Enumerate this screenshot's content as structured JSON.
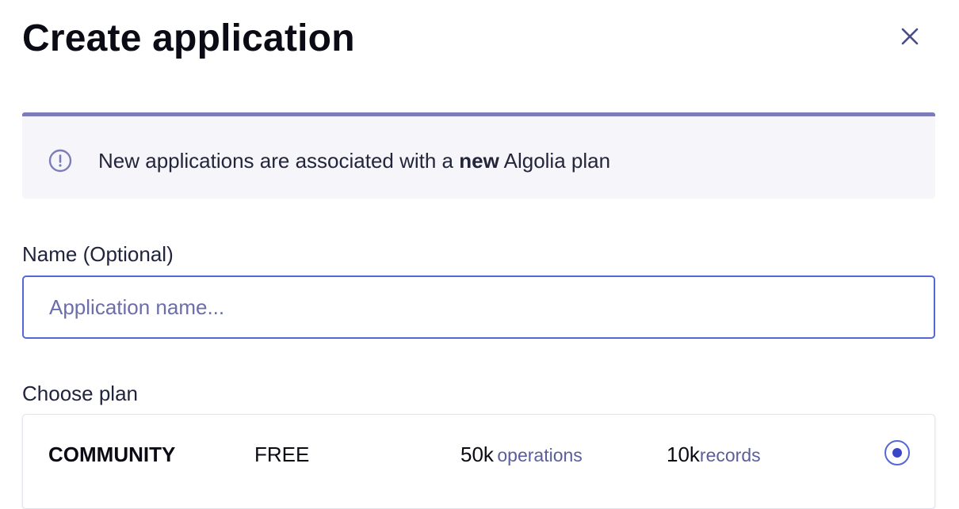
{
  "dialog": {
    "title": "Create application",
    "close_icon": "close-icon"
  },
  "banner": {
    "icon": "info-circle-icon",
    "text_before": "New applications are associated with a ",
    "text_bold": "new",
    "text_after": " Algolia plan"
  },
  "name_field": {
    "label": "Name (Optional)",
    "value": "",
    "placeholder": "Application name..."
  },
  "plan": {
    "label": "Choose plan",
    "options": [
      {
        "name": "COMMUNITY",
        "price": "FREE",
        "operations_value": "50k",
        "operations_unit": "operations",
        "records_value": "10k",
        "records_unit": "records",
        "selected": true
      }
    ]
  },
  "colors": {
    "accent": "#5468d4",
    "banner_bar": "#7c7db8",
    "banner_bg": "#f5f5fa",
    "muted_text": "#5a5e9a"
  }
}
